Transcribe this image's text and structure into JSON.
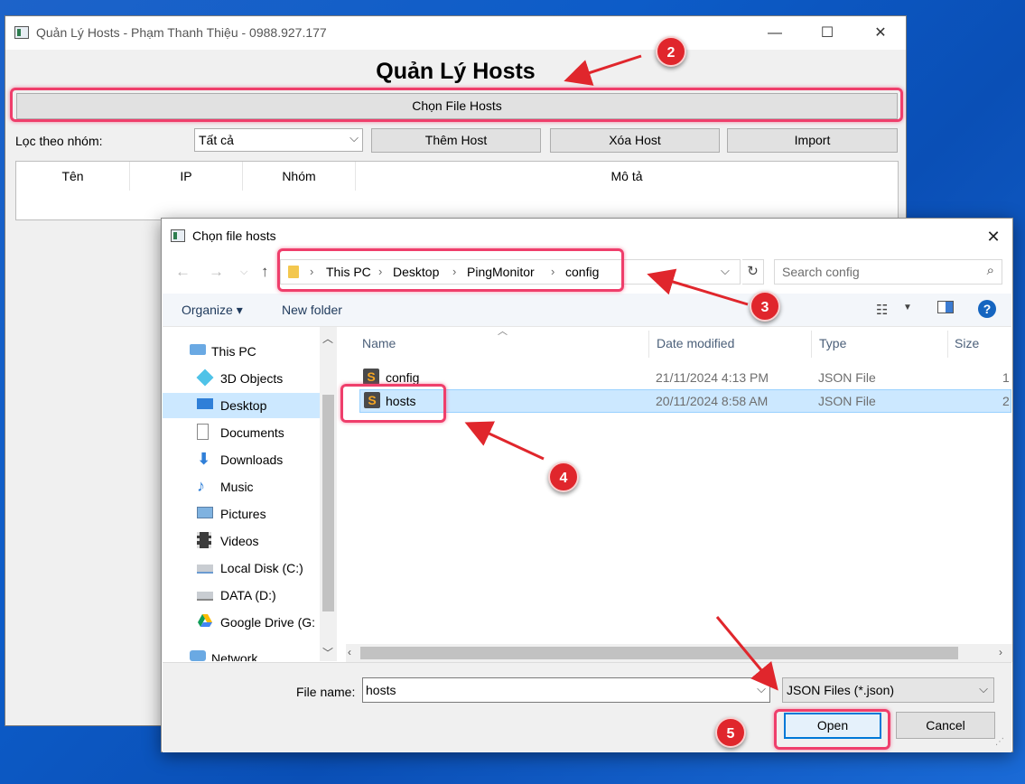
{
  "main_window": {
    "title": "Quản Lý Hosts - Phạm Thanh Thiệu - 0988.927.177",
    "minimize_glyph": "—",
    "maximize_glyph": "☐",
    "close_glyph": "✕",
    "heading": "Quản Lý Hosts",
    "choose_file_button": "Chọn File Hosts",
    "filter_label": "Lọc theo nhóm:",
    "group_select_value": "Tất cả",
    "add_host_button": "Thêm Host",
    "delete_host_button": "Xóa Host",
    "import_button": "Import",
    "table_headers": [
      "Tên",
      "IP",
      "Nhóm",
      "Mô tả"
    ]
  },
  "dialog": {
    "title": "Chọn file hosts",
    "close_glyph": "✕",
    "breadcrumb": [
      "This PC",
      "Desktop",
      "PingMonitor",
      "config"
    ],
    "search_placeholder": "Search config",
    "organize_label": "Organize ▾",
    "new_folder_label": "New folder",
    "help_glyph": "?",
    "nav_items": [
      {
        "label": "This PC",
        "icon": "computer-icon"
      },
      {
        "label": "3D Objects",
        "icon": "cube-icon"
      },
      {
        "label": "Desktop",
        "icon": "desktop-icon",
        "selected": true
      },
      {
        "label": "Documents",
        "icon": "document-icon"
      },
      {
        "label": "Downloads",
        "icon": "download-icon"
      },
      {
        "label": "Music",
        "icon": "music-icon"
      },
      {
        "label": "Pictures",
        "icon": "pictures-icon"
      },
      {
        "label": "Videos",
        "icon": "video-icon"
      },
      {
        "label": "Local Disk (C:)",
        "icon": "drive-icon"
      },
      {
        "label": "DATA (D:)",
        "icon": "drive-icon"
      },
      {
        "label": "Google Drive (G:",
        "icon": "google-drive-icon"
      },
      {
        "label": "Network",
        "icon": "network-icon"
      }
    ],
    "columns": [
      "Name",
      "Date modified",
      "Type",
      "Size"
    ],
    "files": [
      {
        "name": "config",
        "date": "21/11/2024 4:13 PM",
        "type": "JSON File",
        "size": "1",
        "selected": false
      },
      {
        "name": "hosts",
        "date": "20/11/2024 8:58 AM",
        "type": "JSON File",
        "size": "2",
        "selected": true
      }
    ],
    "file_name_label": "File name:",
    "file_name_value": "hosts",
    "file_type_filter": "JSON Files (*.json)",
    "open_button": "Open",
    "cancel_button": "Cancel"
  },
  "annotations": {
    "badges": [
      "2",
      "3",
      "4",
      "5"
    ],
    "accent_color": "#ef3e6b",
    "badge_color": "#e0262c",
    "arrow_color": "#e0262c"
  }
}
